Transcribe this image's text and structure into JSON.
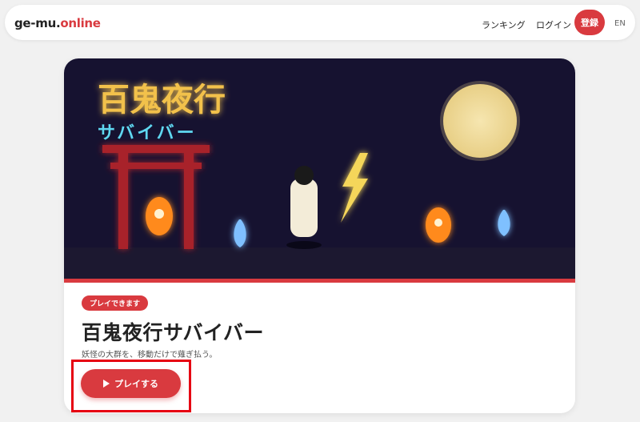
{
  "header": {
    "logo_main": "ge-mu.",
    "logo_accent": "online",
    "nav_ranking": "ランキング",
    "nav_login": "ログイン",
    "register_label": "登録",
    "lang_label": "EN"
  },
  "banner": {
    "title": "百鬼夜行",
    "subtitle": "サバイバー"
  },
  "card": {
    "badge": "プレイできます",
    "title": "百鬼夜行サバイバー",
    "description": "妖怪の大群を、移動だけで薙ぎ払う。",
    "play_label": "プレイする"
  },
  "colors": {
    "accent": "#d93a3f",
    "banner_bg": "#161230",
    "title_gold": "#f2c14b",
    "subtitle_cyan": "#5fd7f0",
    "highlight_frame": "#e60012"
  },
  "icons": [
    "play-icon",
    "moon-icon",
    "torii-icon",
    "lightning-icon",
    "spirit-flame-icon",
    "character-icon"
  ]
}
